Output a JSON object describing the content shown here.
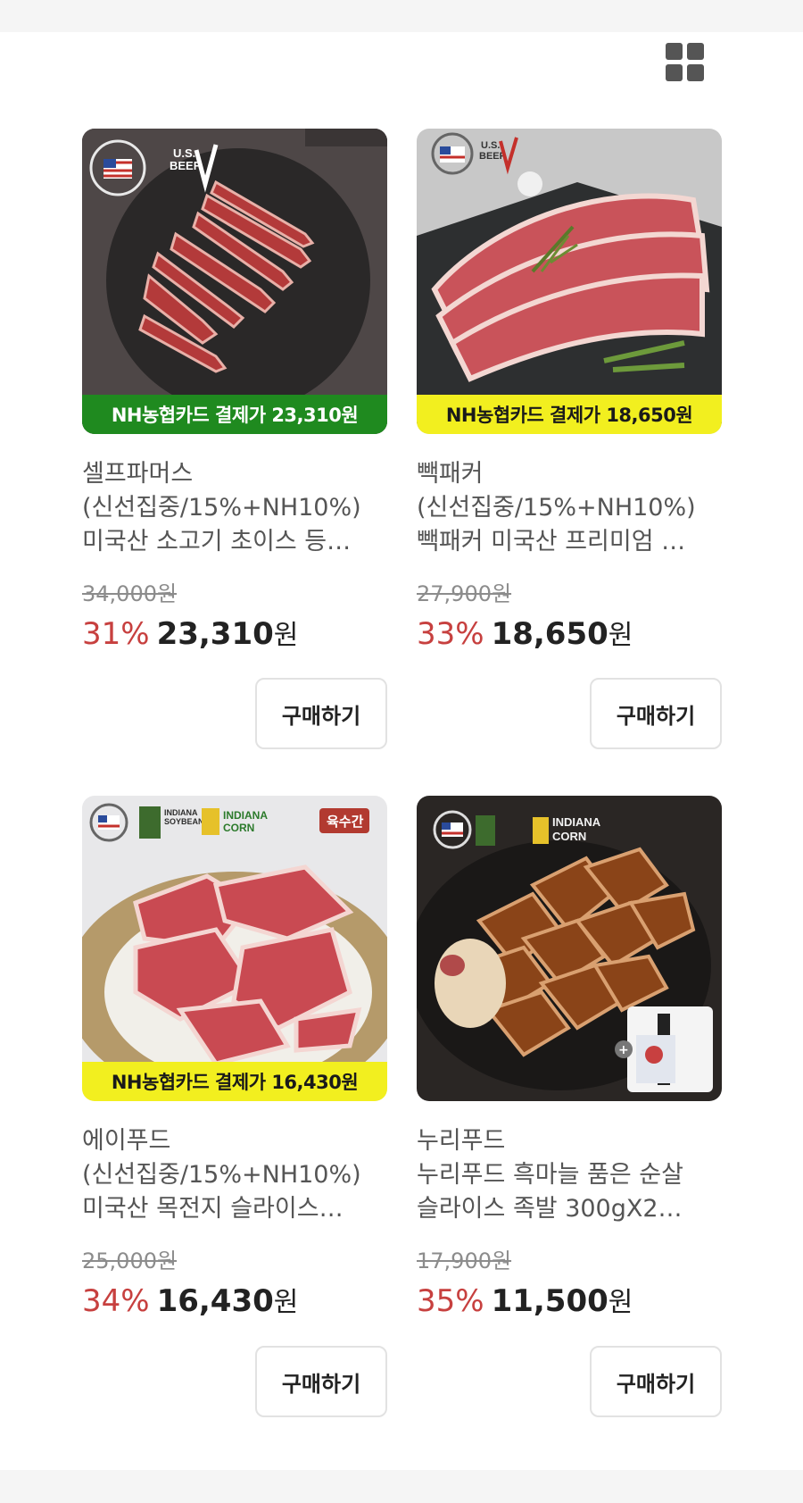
{
  "view_toggle": {
    "icon": "grid-view-icon"
  },
  "products": [
    {
      "banner": "NH농협카드 결제가 23,310원",
      "banner_color": "#1f8a1f",
      "brand": "셀프파머스",
      "name_line1": "(신선집중/15%+NH10%)",
      "name_line2": "미국산 소고기 초이스 등…",
      "original_price": "34,000원",
      "discount": "31%",
      "price": "23,310",
      "currency": "원",
      "buy_label": "구매하기",
      "logos": [
        "U.S.MEAT",
        "U.S. BEEF"
      ]
    },
    {
      "banner": "NH농협카드 결제가 18,650원",
      "banner_color": "#f2ef1f",
      "brand": "빽패커",
      "name_line1": "(신선집중/15%+NH10%)",
      "name_line2": "빽패커 미국산 프리미엄 …",
      "original_price": "27,900원",
      "discount": "33%",
      "price": "18,650",
      "currency": "원",
      "buy_label": "구매하기",
      "logos": [
        "U.S.MEAT",
        "U.S. BEEF"
      ]
    },
    {
      "banner": "NH농협카드 결제가 16,430원",
      "banner_color": "#f2ef1f",
      "brand": "에이푸드",
      "name_line1": "(신선집중/15%+NH10%)",
      "name_line2": "미국산 목전지 슬라이스…",
      "original_price": "25,000원",
      "discount": "34%",
      "price": "16,430",
      "currency": "원",
      "buy_label": "구매하기",
      "logos": [
        "U.S.MEAT",
        "INDIANA SOYBEAN ALLIANCE",
        "INDIANA CORN",
        "육수간"
      ]
    },
    {
      "brand": "누리푸드",
      "name_line1": "누리푸드 흑마늘 품은 순살",
      "name_line2": "슬라이스 족발 300gX2…",
      "original_price": "17,900원",
      "discount": "35%",
      "price": "11,500",
      "currency": "원",
      "buy_label": "구매하기",
      "logos": [
        "U.S.MEAT",
        "INDIANA SOYBEAN ALLIANCE",
        "INDIANA CORN"
      ]
    }
  ]
}
